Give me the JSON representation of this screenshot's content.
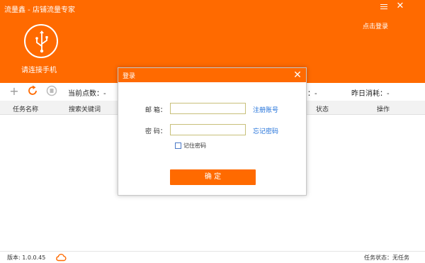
{
  "app": {
    "title": "流量鑫 - 店铺流量专家",
    "login_link": "点击登录",
    "connect_label": "请连接手机"
  },
  "toolbar": {
    "current_points_label": "当前点数：-",
    "middle_value": "：-",
    "yesterday_label": "昨日消耗：-"
  },
  "table": {
    "columns": [
      "任务名称",
      "搜索关键词",
      "状态",
      "操作"
    ]
  },
  "status": {
    "version": "版本: 1.0.0.45",
    "task_status": "任务状态：无任务"
  },
  "login_dialog": {
    "title": "登录",
    "email_label": "邮  箱：",
    "email_value": "",
    "register_link": "注册账号",
    "password_label": "密  码：",
    "password_value": "",
    "forgot_link": "忘记密码",
    "remember_label": "记住密码",
    "remember_checked": false,
    "confirm_label": "确 定"
  },
  "colors": {
    "brand": "#ff6a00",
    "link": "#1e6fd9"
  },
  "icons": [
    "menu-icon",
    "close-icon",
    "usb-icon",
    "add-icon",
    "refresh-icon",
    "stop-icon",
    "cloud-icon"
  ]
}
